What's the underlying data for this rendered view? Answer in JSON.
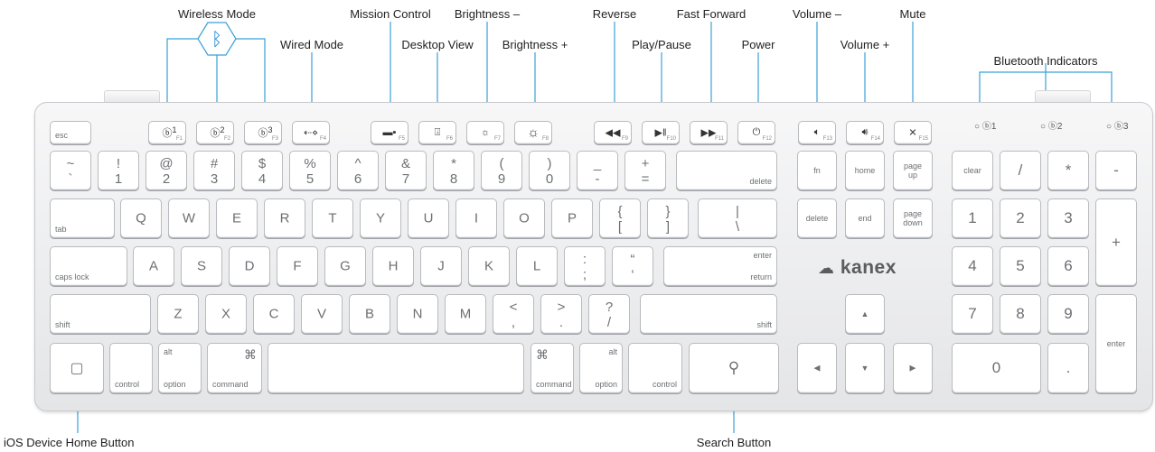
{
  "callouts": {
    "wireless_mode": "Wireless Mode",
    "mission_control": "Mission Control",
    "brightness_minus": "Brightness –",
    "reverse": "Reverse",
    "fast_forward": "Fast Forward",
    "volume_minus": "Volume –",
    "mute": "Mute",
    "wired_mode": "Wired Mode",
    "desktop_view": "Desktop View",
    "brightness_plus": "Brightness +",
    "play_pause": "Play/Pause",
    "power": "Power",
    "volume_plus": "Volume +",
    "bluetooth_indicators": "Bluetooth Indicators",
    "ios_home_button": "iOS Device Home Button",
    "search_button": "Search Button"
  },
  "brand": {
    "logo": "kanex",
    "bluetooth_color": "#1e88d6",
    "line_color": "#3aa0d8"
  },
  "indicators": {
    "i1": "1",
    "i2": "2",
    "i3": "3"
  },
  "function_row": {
    "esc": "esc",
    "f1": "F1",
    "f2": "F2",
    "f3": "F3",
    "f4": "F4",
    "f5": "F5",
    "f6": "F6",
    "f7": "F7",
    "f8": "F8",
    "f9": "F9",
    "f10": "F10",
    "f11": "F11",
    "f12": "F12",
    "f13": "F13",
    "f14": "F14",
    "f15": "F15",
    "bt1": "1",
    "bt2": "2",
    "bt3": "3"
  },
  "number_row": [
    {
      "top": "~",
      "bottom": "`"
    },
    {
      "top": "!",
      "bottom": "1"
    },
    {
      "top": "@",
      "bottom": "2"
    },
    {
      "top": "#",
      "bottom": "3"
    },
    {
      "top": "$",
      "bottom": "4"
    },
    {
      "top": "%",
      "bottom": "5"
    },
    {
      "top": "^",
      "bottom": "6"
    },
    {
      "top": "&",
      "bottom": "7"
    },
    {
      "top": "*",
      "bottom": "8"
    },
    {
      "top": "(",
      "bottom": "9"
    },
    {
      "top": ")",
      "bottom": "0"
    },
    {
      "top": "_",
      "bottom": "-"
    },
    {
      "top": "+",
      "bottom": "="
    }
  ],
  "delete_label": "delete",
  "tab_label": "tab",
  "qwerty": [
    "Q",
    "W",
    "E",
    "R",
    "T",
    "Y",
    "U",
    "I",
    "O",
    "P"
  ],
  "brackets": [
    {
      "top": "{",
      "bottom": "["
    },
    {
      "top": "}",
      "bottom": "]"
    },
    {
      "top": "|",
      "bottom": "\\"
    }
  ],
  "caps_label": "caps lock",
  "asdf": [
    "A",
    "S",
    "D",
    "F",
    "G",
    "H",
    "J",
    "K",
    "L"
  ],
  "semi": [
    {
      "top": ":",
      "bottom": ";"
    },
    {
      "top": "“",
      "bottom": "‘"
    }
  ],
  "enter_top": "enter",
  "return_label": "return",
  "shift_label": "shift",
  "zxcv": [
    "Z",
    "X",
    "C",
    "V",
    "B",
    "N",
    "M"
  ],
  "punct": [
    {
      "top": "<",
      "bottom": ","
    },
    {
      "top": ">",
      "bottom": "."
    },
    {
      "top": "?",
      "bottom": "/"
    }
  ],
  "bottom_row": {
    "control": "control",
    "alt": "alt",
    "option": "option",
    "command": "command",
    "cmd_symbol": "⌘"
  },
  "nav": {
    "fn": "fn",
    "home": "home",
    "page_up": "page\nup",
    "delete": "delete",
    "end": "end",
    "page_down": "page\ndown"
  },
  "numpad": {
    "clear": "clear",
    "slash": "/",
    "star": "*",
    "minus": "-",
    "n7": "7",
    "n8": "8",
    "n9": "9",
    "plus": "+",
    "n4": "4",
    "n5": "5",
    "n6": "6",
    "n1": "1",
    "n2": "2",
    "n3": "3",
    "enter": "enter",
    "n0": "0",
    "dot": "."
  }
}
